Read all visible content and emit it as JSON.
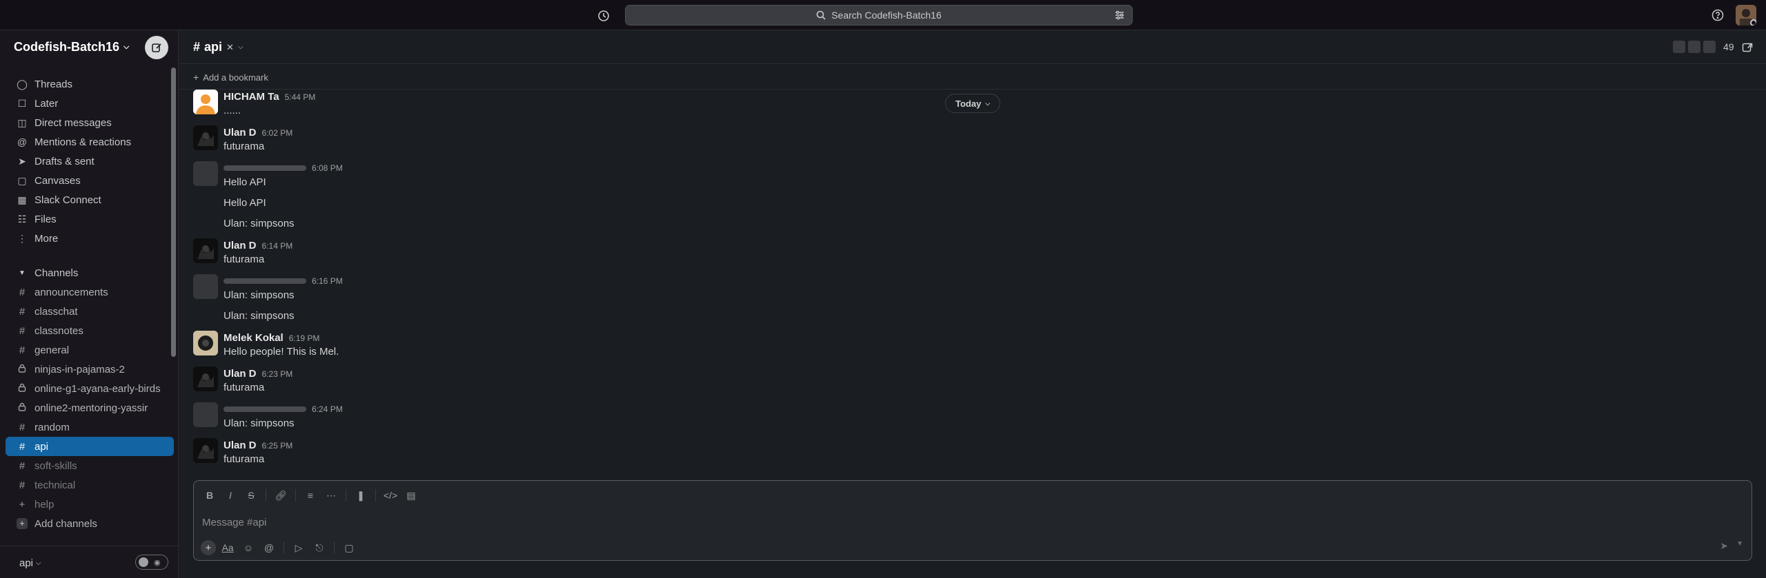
{
  "topbar": {
    "search_placeholder": "Search Codefish-Batch16"
  },
  "workspace": {
    "name": "Codefish-Batch16"
  },
  "nav": [
    {
      "label": "Threads",
      "icon": "threads-icon"
    },
    {
      "label": "Later",
      "icon": "bookmark-icon"
    },
    {
      "label": "Direct messages",
      "icon": "dm-icon"
    },
    {
      "label": "Mentions & reactions",
      "icon": "at-icon"
    },
    {
      "label": "Drafts & sent",
      "icon": "send-icon"
    },
    {
      "label": "Canvases",
      "icon": "canvas-icon"
    },
    {
      "label": "Slack Connect",
      "icon": "building-icon"
    },
    {
      "label": "Files",
      "icon": "files-icon"
    },
    {
      "label": "More",
      "icon": "more-icon"
    }
  ],
  "channels_section": {
    "label": "Channels",
    "items": [
      {
        "label": "announcements",
        "icon": "hash"
      },
      {
        "label": "classchat",
        "icon": "hash"
      },
      {
        "label": "classnotes",
        "icon": "hash"
      },
      {
        "label": "general",
        "icon": "hash"
      },
      {
        "label": "ninjas-in-pajamas-2",
        "icon": "lock"
      },
      {
        "label": "online-g1-ayana-early-birds",
        "icon": "lock"
      },
      {
        "label": "online2-mentoring-yassir",
        "icon": "lock"
      },
      {
        "label": "random",
        "icon": "hash"
      },
      {
        "label": "api",
        "icon": "hash",
        "active": true
      },
      {
        "label": "soft-skills",
        "icon": "hash"
      },
      {
        "label": "technical",
        "icon": "hash"
      },
      {
        "label": "help",
        "icon": "plus"
      },
      {
        "label": "Add channels",
        "icon": "add"
      }
    ]
  },
  "huddle": {
    "channel": "api"
  },
  "channel": {
    "name": "api",
    "member_count": "49",
    "bookmark_label": "Add a bookmark"
  },
  "date_divider": "Today",
  "messages": [
    {
      "author": "HICHAM Ta",
      "time": "5:44 PM",
      "avatar": "hicham",
      "lines": [
        "......"
      ]
    },
    {
      "author": "Ulan D",
      "time": "6:02 PM",
      "avatar": "ulan",
      "lines": [
        "futurama"
      ]
    },
    {
      "author": "",
      "time": "6:08 PM",
      "avatar": "placeholder",
      "lines": [
        "Hello API",
        "Hello API",
        "Ulan: simpsons"
      ]
    },
    {
      "author": "Ulan D",
      "time": "6:14 PM",
      "avatar": "ulan",
      "lines": [
        "futurama"
      ]
    },
    {
      "author": "",
      "time": "6:16 PM",
      "avatar": "placeholder",
      "lines": [
        "Ulan: simpsons",
        "Ulan: simpsons"
      ]
    },
    {
      "author": "Melek Kokal",
      "time": "6:19 PM",
      "avatar": "mel",
      "lines": [
        "Hello people! This is Mel."
      ]
    },
    {
      "author": "Ulan D",
      "time": "6:23 PM",
      "avatar": "ulan",
      "lines": [
        "futurama"
      ]
    },
    {
      "author": "",
      "time": "6:24 PM",
      "avatar": "placeholder",
      "lines": [
        "Ulan: simpsons"
      ]
    },
    {
      "author": "Ulan D",
      "time": "6:25 PM",
      "avatar": "ulan",
      "lines": [
        "futurama"
      ]
    }
  ],
  "composer": {
    "placeholder": "Message #api"
  }
}
